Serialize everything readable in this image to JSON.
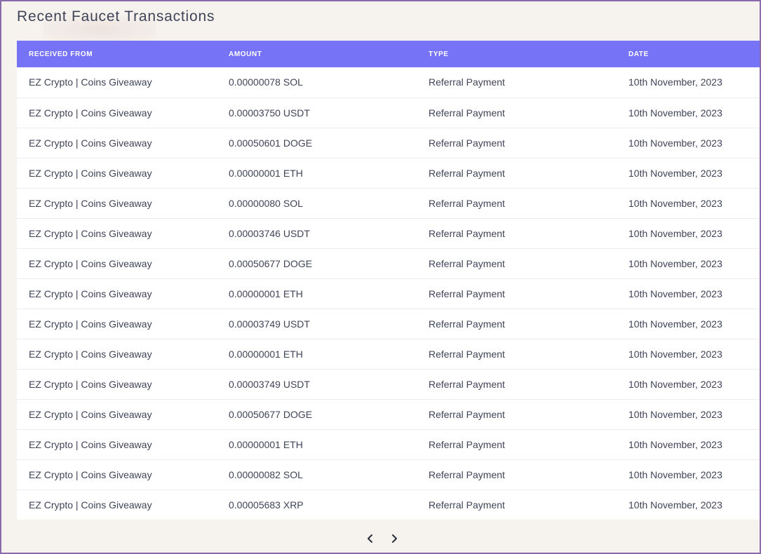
{
  "page": {
    "title": "Recent Faucet Transactions"
  },
  "table": {
    "columns": [
      "RECEIVED FROM",
      "AMOUNT",
      "TYPE",
      "DATE"
    ],
    "rows": [
      [
        "EZ Crypto | Coins Giveaway",
        "0.00000078 SOL",
        "Referral Payment",
        "10th November, 2023"
      ],
      [
        "EZ Crypto | Coins Giveaway",
        "0.00003750 USDT",
        "Referral Payment",
        "10th November, 2023"
      ],
      [
        "EZ Crypto | Coins Giveaway",
        "0.00050601 DOGE",
        "Referral Payment",
        "10th November, 2023"
      ],
      [
        "EZ Crypto | Coins Giveaway",
        "0.00000001 ETH",
        "Referral Payment",
        "10th November, 2023"
      ],
      [
        "EZ Crypto | Coins Giveaway",
        "0.00000080 SOL",
        "Referral Payment",
        "10th November, 2023"
      ],
      [
        "EZ Crypto | Coins Giveaway",
        "0.00003746 USDT",
        "Referral Payment",
        "10th November, 2023"
      ],
      [
        "EZ Crypto | Coins Giveaway",
        "0.00050677 DOGE",
        "Referral Payment",
        "10th November, 2023"
      ],
      [
        "EZ Crypto | Coins Giveaway",
        "0.00000001 ETH",
        "Referral Payment",
        "10th November, 2023"
      ],
      [
        "EZ Crypto | Coins Giveaway",
        "0.00003749 USDT",
        "Referral Payment",
        "10th November, 2023"
      ],
      [
        "EZ Crypto | Coins Giveaway",
        "0.00000001 ETH",
        "Referral Payment",
        "10th November, 2023"
      ],
      [
        "EZ Crypto | Coins Giveaway",
        "0.00003749 USDT",
        "Referral Payment",
        "10th November, 2023"
      ],
      [
        "EZ Crypto | Coins Giveaway",
        "0.00050677 DOGE",
        "Referral Payment",
        "10th November, 2023"
      ],
      [
        "EZ Crypto | Coins Giveaway",
        "0.00000001 ETH",
        "Referral Payment",
        "10th November, 2023"
      ],
      [
        "EZ Crypto | Coins Giveaway",
        "0.00000082 SOL",
        "Referral Payment",
        "10th November, 2023"
      ],
      [
        "EZ Crypto | Coins Giveaway",
        "0.00005683 XRP",
        "Referral Payment",
        "10th November, 2023"
      ]
    ]
  },
  "pagination": {
    "prev_icon": "chevron-left-icon",
    "next_icon": "chevron-right-icon"
  },
  "colors": {
    "header_bg": "#7773f7",
    "page_bg": "#f6f2ee",
    "frame_border": "#8a6aa8",
    "text": "#3f4458"
  }
}
